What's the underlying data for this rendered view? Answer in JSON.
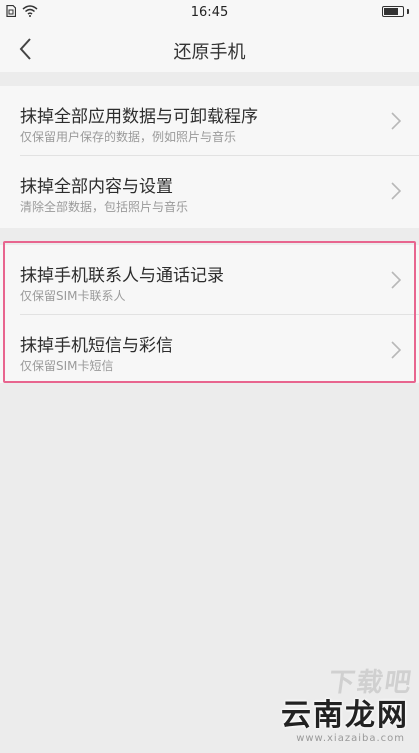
{
  "status_bar": {
    "time": "16:45",
    "icons": [
      "sim-icon",
      "wifi-icon",
      "battery-icon"
    ],
    "battery_level": 0.8
  },
  "nav": {
    "back_icon": "chevron-left-icon",
    "title": "还原手机"
  },
  "section1": {
    "items": [
      {
        "title": "抹掉全部应用数据与可卸载程序",
        "subtitle": "仅保留用户保存的数据，例如照片与音乐"
      },
      {
        "title": "抹掉全部内容与设置",
        "subtitle": "清除全部数据，包括照片与音乐"
      }
    ]
  },
  "section2": {
    "items": [
      {
        "title": "抹掉手机联系人与通话记录",
        "subtitle": "仅保留SIM卡联系人"
      },
      {
        "title": "抹掉手机短信与彩信",
        "subtitle": "仅保留SIM卡短信"
      }
    ]
  },
  "watermark": {
    "top": "下载吧",
    "main": "云南龙网",
    "url": "www.xiazaiba.com"
  },
  "colors": {
    "background": "#ececec",
    "card": "#f7f7f7",
    "highlight": "#e8658f",
    "subtitle": "#9a9a9a"
  }
}
